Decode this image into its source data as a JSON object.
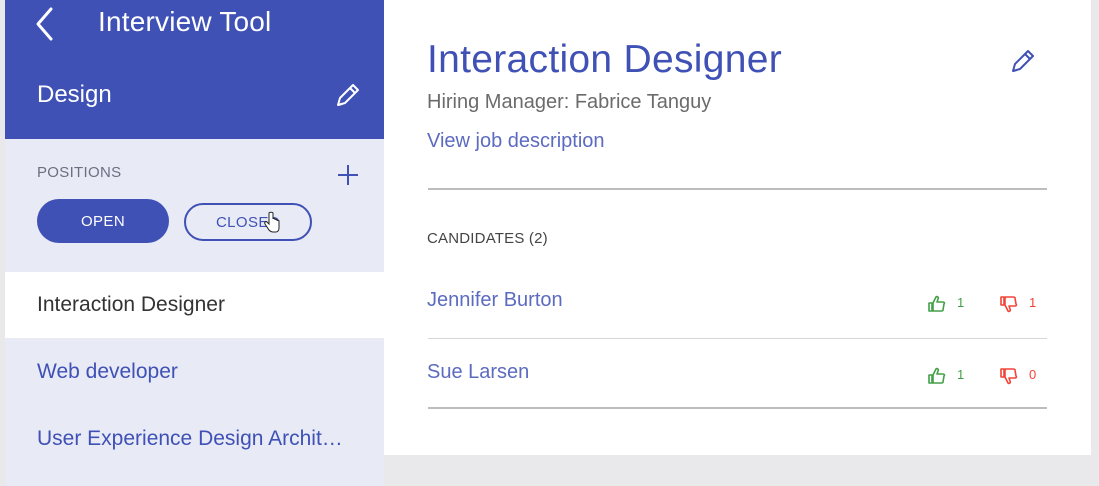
{
  "app": {
    "title": "Interview Tool",
    "department": "Design"
  },
  "sidebar": {
    "positions_label": "POSITIONS",
    "filters": {
      "open_label": "OPEN",
      "closed_label": "CLOSED"
    },
    "items": [
      {
        "label": "Interaction Designer",
        "active": true
      },
      {
        "label": "Web developer",
        "active": false
      },
      {
        "label": "User Experience Design Archit…",
        "active": false
      }
    ]
  },
  "main": {
    "job_title": "Interaction Designer",
    "hiring_manager": "Hiring Manager: Fabrice Tanguy",
    "view_description": "View job description",
    "candidates_label": "CANDIDATES (2)",
    "candidates": [
      {
        "name": "Jennifer Burton",
        "thumbs_up": "1",
        "thumbs_down": "1"
      },
      {
        "name": "Sue Larsen",
        "thumbs_up": "1",
        "thumbs_down": "0"
      }
    ]
  },
  "colors": {
    "primary": "#3f51b5",
    "link": "#5c6bc0",
    "sidebar_bg": "#e8eaf6",
    "thumb_up": "#43a047",
    "thumb_down": "#f44336"
  },
  "icons": {
    "back": "chevron-left-icon",
    "edit": "pencil-icon",
    "add": "plus-icon",
    "thumb_up": "thumbs-up-icon",
    "thumb_down": "thumbs-down-icon"
  }
}
